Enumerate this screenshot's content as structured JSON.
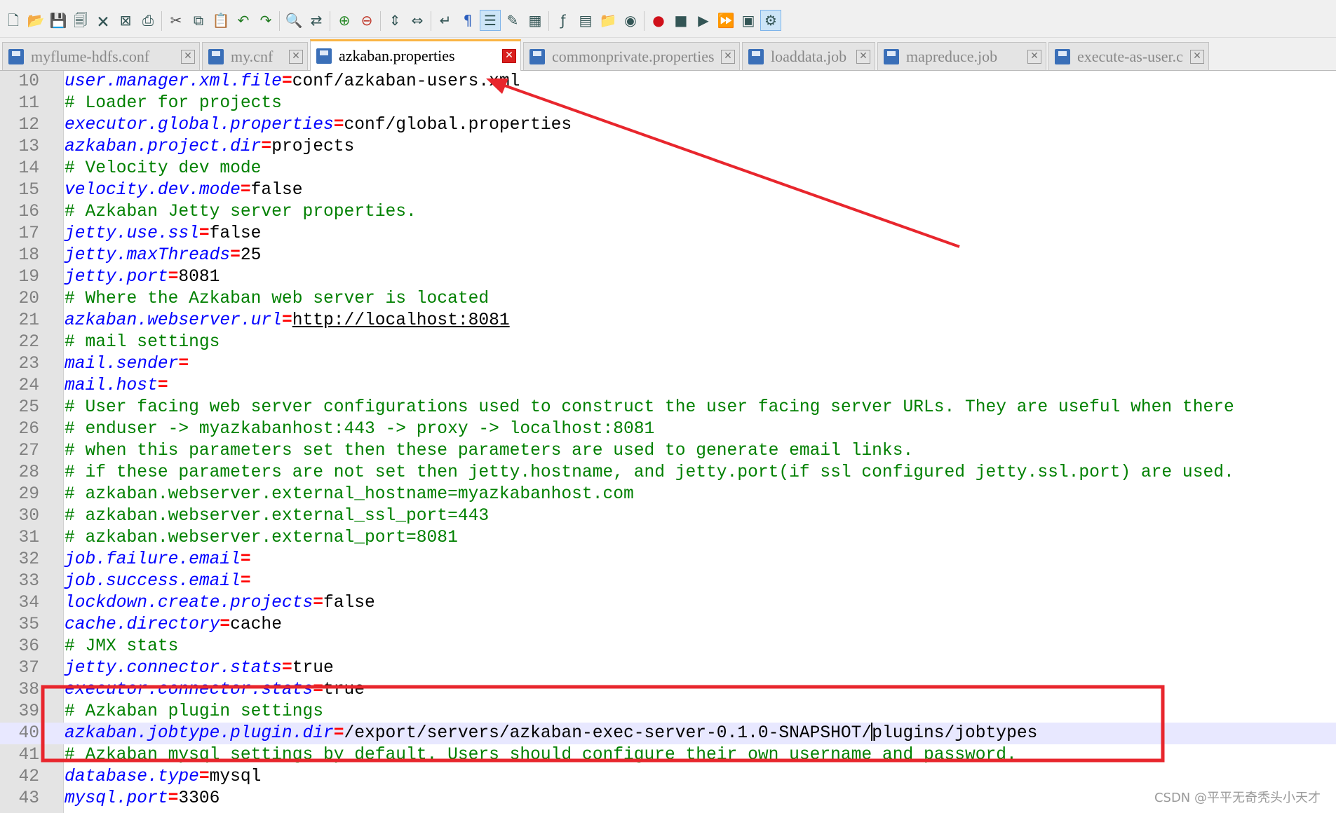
{
  "toolbar": {
    "icons": [
      "new-file-icon",
      "open-file-icon",
      "save-icon",
      "save-all-icon",
      "close-icon",
      "close-all-icon",
      "print-icon",
      "cut-icon",
      "copy-icon",
      "paste-icon",
      "undo-icon",
      "redo-icon",
      "find-icon",
      "replace-icon",
      "zoom-in-icon",
      "zoom-out-icon",
      "sync-vertical-icon",
      "sync-horizontal-icon",
      "word-wrap-icon",
      "show-all-chars-icon",
      "indent-guide-icon",
      "user-language-icon",
      "doc-map-icon",
      "function-list-icon",
      "folder-workspace-icon",
      "folder-icon",
      "monitor-icon",
      "record-macro-icon",
      "stop-macro-icon",
      "play-macro-icon",
      "run-macro-multiple-icon",
      "save-macro-icon",
      "plugin-icon"
    ]
  },
  "tabs": [
    {
      "label": "myflume-hdfs.conf",
      "active": false
    },
    {
      "label": "my.cnf",
      "active": false
    },
    {
      "label": "azkaban.properties",
      "active": true
    },
    {
      "label": "commonprivate.properties",
      "active": false
    },
    {
      "label": "loaddata.job",
      "active": false
    },
    {
      "label": "mapreduce.job",
      "active": false
    },
    {
      "label": "execute-as-user.c",
      "active": false
    }
  ],
  "editor": {
    "current_line": 40,
    "lines": [
      {
        "n": "10",
        "key": "user.manager.xml.file",
        "eq": "=",
        "val": "conf/azkaban-users.xml"
      },
      {
        "n": "11",
        "comment": "# Loader for projects"
      },
      {
        "n": "12",
        "key": "executor.global.properties",
        "eq": "=",
        "val": "conf/global.properties"
      },
      {
        "n": "13",
        "key": "azkaban.project.dir",
        "eq": "=",
        "val": "projects"
      },
      {
        "n": "14",
        "comment": "# Velocity dev mode"
      },
      {
        "n": "15",
        "key": "velocity.dev.mode",
        "eq": "=",
        "val": "false"
      },
      {
        "n": "16",
        "comment": "# Azkaban Jetty server properties."
      },
      {
        "n": "17",
        "key": "jetty.use.ssl",
        "eq": "=",
        "val": "false"
      },
      {
        "n": "18",
        "key": "jetty.maxThreads",
        "eq": "=",
        "val": "25"
      },
      {
        "n": "19",
        "key": "jetty.port",
        "eq": "=",
        "val": "8081"
      },
      {
        "n": "20",
        "comment": "# Where the Azkaban web server is located"
      },
      {
        "n": "21",
        "key": "azkaban.webserver.url",
        "eq": "=",
        "url": "http://localhost:8081"
      },
      {
        "n": "22",
        "comment": "# mail settings"
      },
      {
        "n": "23",
        "key": "mail.sender",
        "eq": "=",
        "val": ""
      },
      {
        "n": "24",
        "key": "mail.host",
        "eq": "=",
        "val": ""
      },
      {
        "n": "25",
        "comment": "# User facing web server configurations used to construct the user facing server URLs. They are useful when there"
      },
      {
        "n": "26",
        "comment": "# enduser -> myazkabanhost:443 -> proxy -> localhost:8081"
      },
      {
        "n": "27",
        "comment": "# when this parameters set then these parameters are used to generate email links."
      },
      {
        "n": "28",
        "comment": "# if these parameters are not set then jetty.hostname, and jetty.port(if ssl configured jetty.ssl.port) are used."
      },
      {
        "n": "29",
        "comment": "# azkaban.webserver.external_hostname=myazkabanhost.com"
      },
      {
        "n": "30",
        "comment": "# azkaban.webserver.external_ssl_port=443"
      },
      {
        "n": "31",
        "comment": "# azkaban.webserver.external_port=8081"
      },
      {
        "n": "32",
        "key": "job.failure.email",
        "eq": "=",
        "val": ""
      },
      {
        "n": "33",
        "key": "job.success.email",
        "eq": "=",
        "val": ""
      },
      {
        "n": "34",
        "key": "lockdown.create.projects",
        "eq": "=",
        "val": "false"
      },
      {
        "n": "35",
        "key": "cache.directory",
        "eq": "=",
        "val": "cache"
      },
      {
        "n": "36",
        "comment": "# JMX stats"
      },
      {
        "n": "37",
        "key": "jetty.connector.stats",
        "eq": "=",
        "val": "true"
      },
      {
        "n": "38",
        "key": "executor.connector.stats",
        "eq": "=",
        "val": "true"
      },
      {
        "n": "39",
        "comment": "# Azkaban plugin settings"
      },
      {
        "n": "40",
        "key": "azkaban.jobtype.plugin.dir",
        "eq": "=",
        "val": "/export/servers/azkaban-exec-server-0.1.0-SNAPSHOT/",
        "val_after_caret": "plugins/jobtypes"
      },
      {
        "n": "41",
        "comment": "# Azkaban mysql settings by default. Users should configure their own username and password."
      },
      {
        "n": "42",
        "key": "database.type",
        "eq": "=",
        "val": "mysql"
      },
      {
        "n": "43",
        "key": "mysql.port",
        "eq": "=",
        "val": "3306"
      }
    ]
  },
  "annotation": {
    "color": "#e8262d"
  },
  "watermark": "CSDN @平平无奇秃头小天才"
}
